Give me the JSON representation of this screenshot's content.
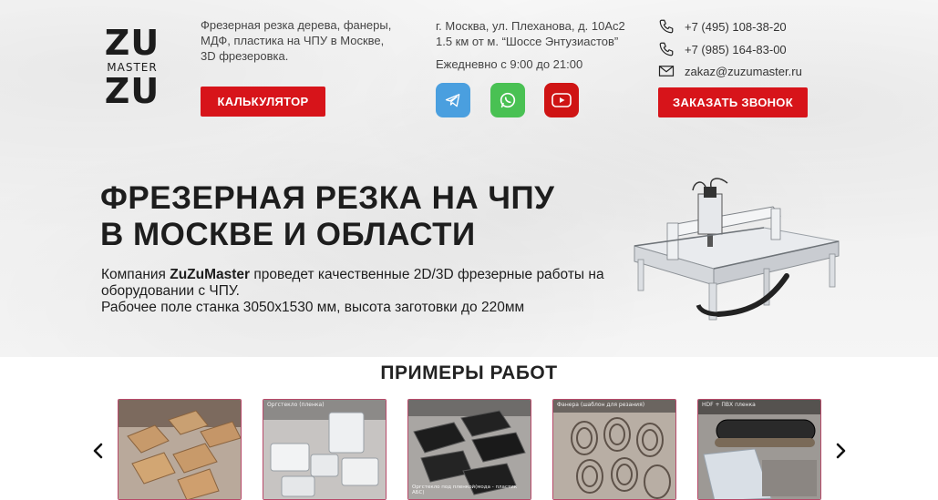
{
  "header": {
    "logo": {
      "line1": "ZU",
      "line2": "MASTER",
      "line3": "ZU"
    },
    "description": "Фрезерная резка дерева, фанеры, МДФ, пластика на ЧПУ в Москве, 3D фрезеровка.",
    "calculator_label": "КАЛЬКУЛЯТОР",
    "address_line1": "г. Москва, ул. Плеханова, д. 10Ас2",
    "address_line2": "1.5 км от м. “Шоссе Энтузиастов”",
    "hours": "Ежедневно с 9:00 до 21:00",
    "social": [
      {
        "icon": "telegram-icon",
        "color": "#4a9fdf"
      },
      {
        "icon": "whatsapp-icon",
        "color": "#49c153"
      },
      {
        "icon": "youtube-icon",
        "color": "#cf1414"
      }
    ],
    "phone1": "+7 (495) 108-38-20",
    "phone2": "+7 (985) 164-83-00",
    "email": "zakaz@zuzumaster.ru",
    "callback_label": "ЗАКАЗАТЬ ЗВОНОК"
  },
  "hero": {
    "title_line1": "ФРЕЗЕРНАЯ РЕЗКА НА ЧПУ",
    "title_line2": "В МОСКВЕ И ОБЛАСТИ",
    "text_prefix": "Компания ",
    "text_brand": "ZuZuMaster",
    "text_rest": " проведет качественные 2D/3D фрезерные работы на оборудовании с ЧПУ.",
    "text_line3": "Рабочее поле станка 3050х1530 мм, высота заготовки до 220мм"
  },
  "examples": {
    "title": "ПРИМЕРЫ РАБОТ",
    "items": [
      {
        "caption": ""
      },
      {
        "caption": "Оргстекло (пленка)"
      },
      {
        "caption": "Оргстекло под пленкой(мода - пластик АБС)"
      },
      {
        "caption": "Фанера (шаблон для резания)"
      },
      {
        "caption": "HDF + ПВХ пленка"
      }
    ]
  },
  "colors": {
    "accent": "#d7141a",
    "thumb_border": "#b84a6a"
  }
}
